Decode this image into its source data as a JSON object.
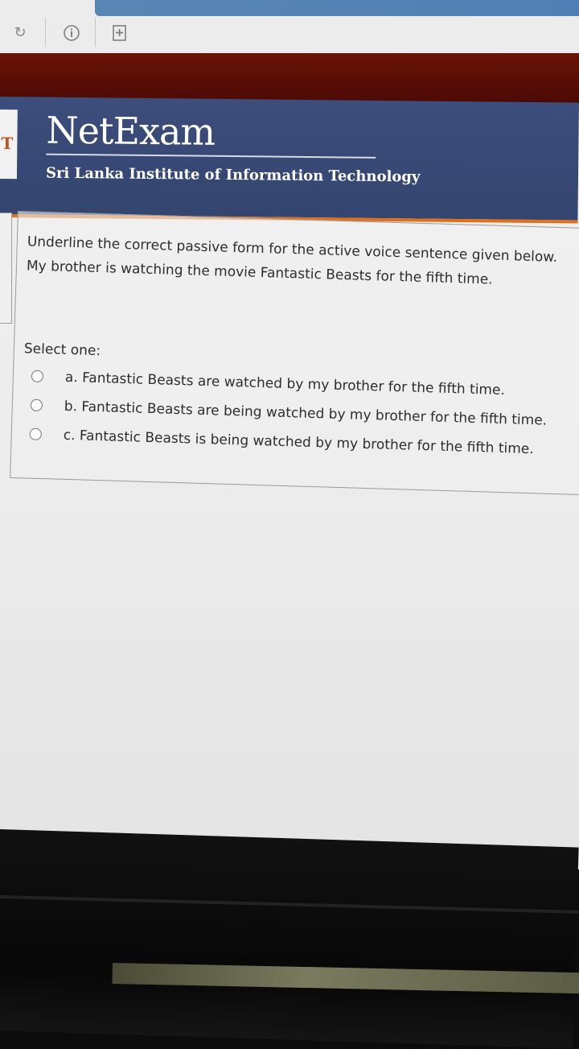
{
  "browser": {
    "icons": {
      "reload": "reload-icon",
      "info": "info-icon",
      "new_tab": "new-tab-icon"
    }
  },
  "header": {
    "brand": "NetExam",
    "institute": "Sri Lanka Institute of Information Technology",
    "logo_letter": "T"
  },
  "question": {
    "instruction": "Underline the correct passive form for the active voice sentence given below.",
    "sentence": "My brother is watching the movie Fantastic Beasts for the fifth time.",
    "select_label": "Select one:",
    "options": [
      {
        "label": "a. Fantastic Beasts are watched by my brother for the fifth time.",
        "selected": false
      },
      {
        "label": "b. Fantastic Beasts are being watched by my brother for the fifth time.",
        "selected": false
      },
      {
        "label": "c. Fantastic Beasts is being watched by my brother for the fifth time.",
        "selected": false
      }
    ]
  },
  "colors": {
    "header_bg": "#3a4a78",
    "header_accent": "#e0701b",
    "maroon": "#5a0e06",
    "url_bar": "#5584b6"
  }
}
